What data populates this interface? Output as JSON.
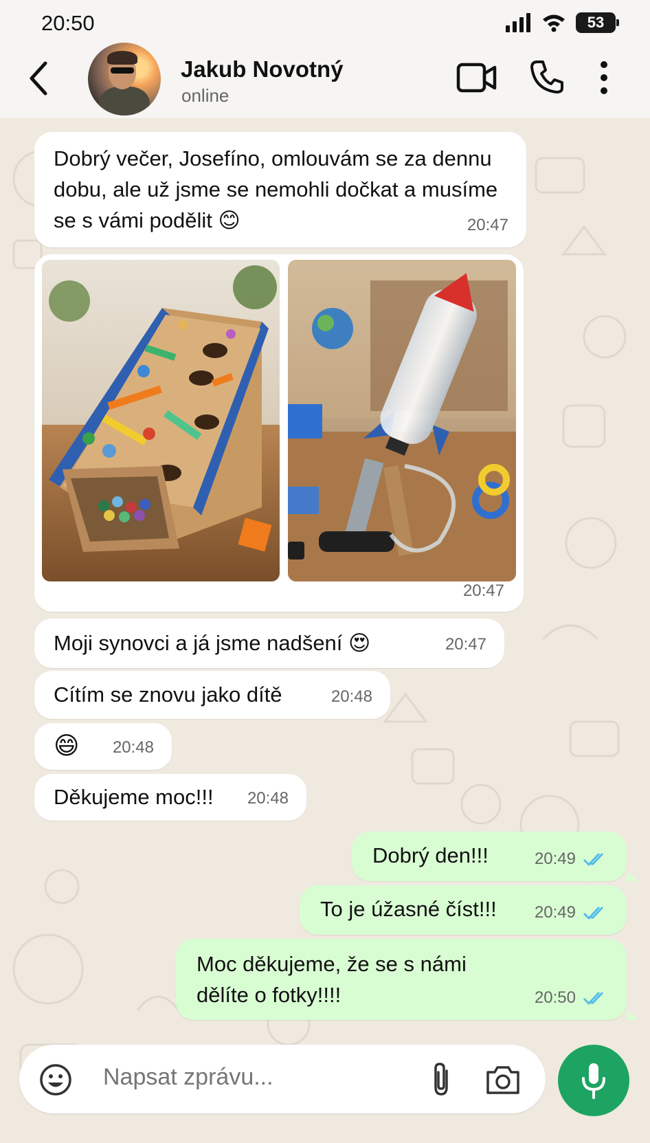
{
  "status_bar": {
    "time": "20:50",
    "battery": "53"
  },
  "header": {
    "contact_name": "Jakub Novotný",
    "contact_status": "online"
  },
  "messages": [
    {
      "text": "Dobrý večer, Josefíno, omlouvám se za dennu dobu, ale už jsme se nemohli dočkat a musíme se s vámi podělit",
      "emoji": "😊",
      "time": "20:47",
      "direction": "in"
    },
    {
      "type": "photos",
      "time": "20:47",
      "direction": "in"
    },
    {
      "text": "Moji synovci a já jsme nadšení",
      "emoji": "😍",
      "time": "20:47",
      "direction": "in"
    },
    {
      "text": "Cítím se znovu jako dítě",
      "time": "20:48",
      "direction": "in"
    },
    {
      "emoji": "😄",
      "time": "20:48",
      "direction": "in"
    },
    {
      "text": "Děkujeme moc!!!",
      "time": "20:48",
      "direction": "in"
    },
    {
      "text": "Dobrý den!!!",
      "time": "20:49",
      "direction": "out",
      "status": "read"
    },
    {
      "text": "To je úžasné číst!!!",
      "time": "20:49",
      "direction": "out",
      "status": "read"
    },
    {
      "text": "Moc děkujeme, že se s námi dělíte o fotky!!!!",
      "time": "20:50",
      "direction": "out",
      "status": "read"
    }
  ],
  "composer": {
    "placeholder": "Napsat zprávu..."
  },
  "icons": {
    "back": "back-arrow-icon",
    "video": "video-call-icon",
    "phone": "phone-icon",
    "more": "more-vert-icon",
    "emoji": "emoji-icon",
    "attach": "paperclip-icon",
    "camera": "camera-icon",
    "mic": "microphone-icon",
    "read_ticks": "double-check-icon"
  },
  "colors": {
    "outgoing_bubble": "#d9fdd3",
    "incoming_bubble": "#ffffff",
    "read_ticks": "#53bdeb",
    "mic_button": "#1da462",
    "chat_background": "#efe9df"
  }
}
